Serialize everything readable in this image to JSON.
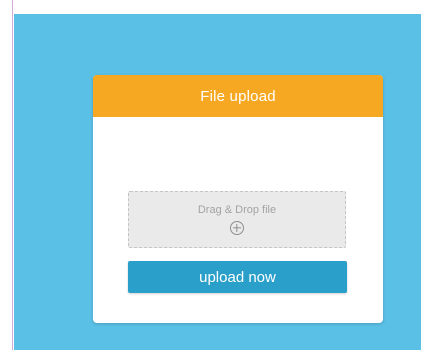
{
  "colors": {
    "stage_background": "#5bc0e6",
    "header_background": "#f7a823",
    "button_background": "#2a9fca",
    "dropzone_background": "#eaeaea"
  },
  "card": {
    "title": "File upload",
    "dropzone": {
      "label": "Drag & Drop file",
      "icon": "plus-circle-icon"
    },
    "upload_button": "upload now"
  }
}
